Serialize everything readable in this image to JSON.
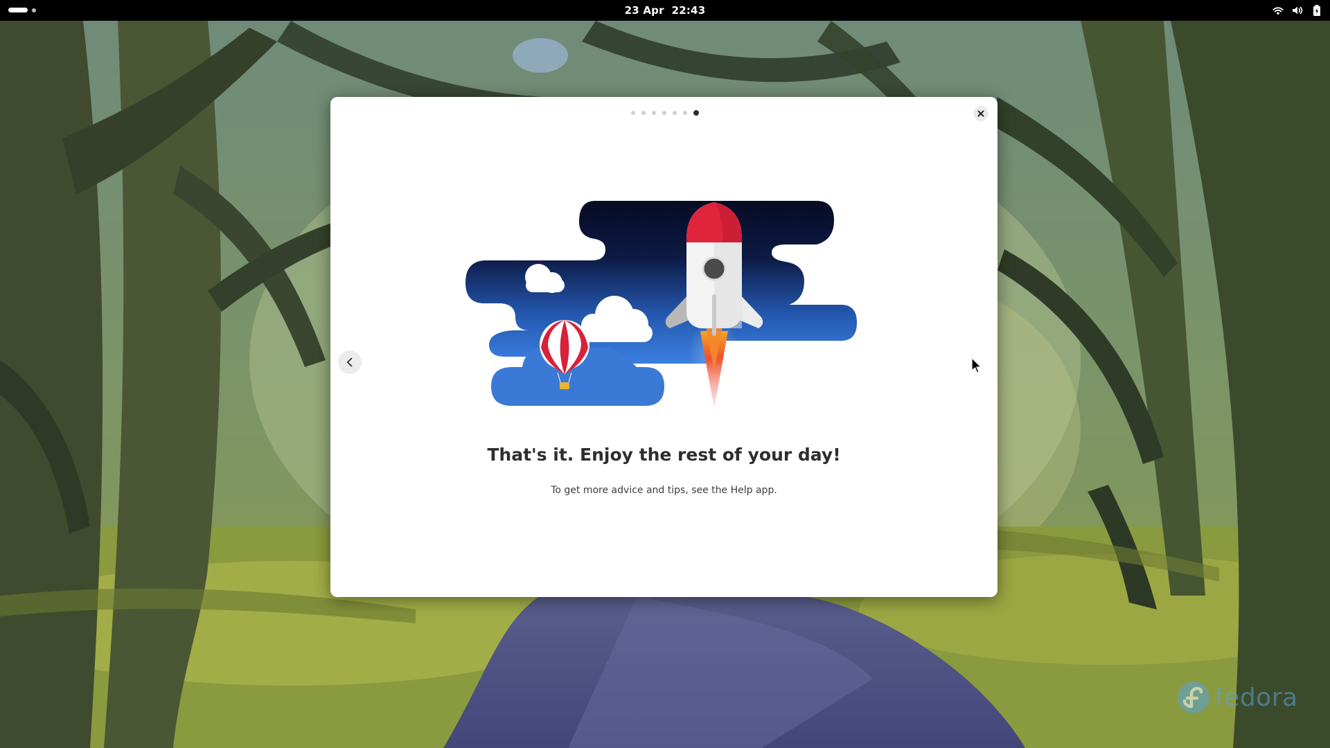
{
  "topbar": {
    "date": "23 Apr",
    "time": "22:43",
    "icons": [
      "wifi-icon",
      "volume-icon",
      "battery-icon"
    ]
  },
  "dialog": {
    "page_count": 7,
    "active_page": 7,
    "headline": "That's it. Enjoy the rest of your day!",
    "subtext": "To get more advice and tips, see the Help app.",
    "close_icon": "close-icon",
    "back_icon": "chevron-left-icon"
  },
  "watermark": {
    "text": "fedora"
  },
  "colors": {
    "topbar": "#000000",
    "dialog_bg": "#ffffff",
    "sky_dark": "#0a1230",
    "sky_blue": "#3a7ad6",
    "rocket_red": "#e0243c",
    "fedora_blue": "#5aa3d8"
  }
}
